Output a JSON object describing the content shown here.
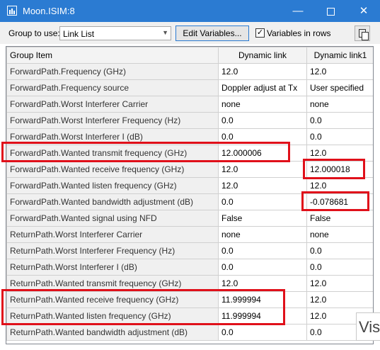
{
  "window": {
    "title": "Moon.ISIM:8",
    "minimize_glyph": "—",
    "close_glyph": "✕"
  },
  "toolbar": {
    "group_label": "Group to use:",
    "group_value": "Link List",
    "edit_label": "Edit Variables...",
    "variables_in_rows_label": "Variables in rows",
    "variables_in_rows_checked": true,
    "check_glyph": "✓"
  },
  "grid": {
    "headers": [
      "Group Item",
      "Dynamic link",
      "Dynamic link1"
    ],
    "rows": [
      {
        "item": "ForwardPath.Frequency (GHz)",
        "v1": "12.0",
        "v2": "12.0"
      },
      {
        "item": "ForwardPath.Frequency source",
        "v1": "Doppler adjust at Tx",
        "v2": "User specified"
      },
      {
        "item": "ForwardPath.Worst Interferer Carrier",
        "v1": "none",
        "v2": "none"
      },
      {
        "item": "ForwardPath.Worst Interferer Frequency (Hz)",
        "v1": "0.0",
        "v2": "0.0"
      },
      {
        "item": "ForwardPath.Worst Interferer I (dB)",
        "v1": "0.0",
        "v2": "0.0"
      },
      {
        "item": "ForwardPath.Wanted transmit frequency (GHz)",
        "v1": "12.000006",
        "v2": "12.0"
      },
      {
        "item": "ForwardPath.Wanted receive frequency (GHz)",
        "v1": "12.0",
        "v2": "12.000018"
      },
      {
        "item": "ForwardPath.Wanted listen frequency (GHz)",
        "v1": "12.0",
        "v2": "12.0"
      },
      {
        "item": "ForwardPath.Wanted bandwidth adjustment (dB)",
        "v1": "0.0",
        "v2": "-0.078681"
      },
      {
        "item": "ForwardPath.Wanted signal using NFD",
        "v1": "False",
        "v2": "False"
      },
      {
        "item": "ReturnPath.Worst Interferer Carrier",
        "v1": "none",
        "v2": "none"
      },
      {
        "item": "ReturnPath.Worst Interferer Frequency (Hz)",
        "v1": "0.0",
        "v2": "0.0"
      },
      {
        "item": "ReturnPath.Worst Interferer I (dB)",
        "v1": "0.0",
        "v2": "0.0"
      },
      {
        "item": "ReturnPath.Wanted transmit frequency (GHz)",
        "v1": "12.0",
        "v2": "12.0"
      },
      {
        "item": "ReturnPath.Wanted receive frequency (GHz)",
        "v1": "11.999994",
        "v2": "12.0"
      },
      {
        "item": "ReturnPath.Wanted listen frequency (GHz)",
        "v1": "11.999994",
        "v2": "12.0"
      },
      {
        "item": "ReturnPath.Wanted bandwidth adjustment (dB)",
        "v1": "0.0",
        "v2": "0.0"
      }
    ]
  },
  "overlay": {
    "watermark_text": "Vis",
    "highlight_color": "#e0101a"
  },
  "colors": {
    "titlebar": "#2b7bd2",
    "item_column_bg": "#f0f0f0"
  }
}
